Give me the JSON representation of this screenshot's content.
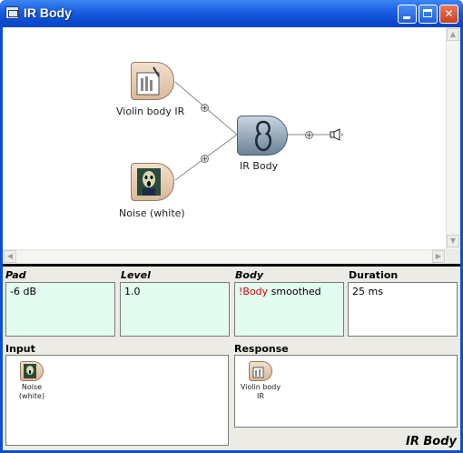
{
  "window": {
    "title": "IR Body"
  },
  "canvas": {
    "nodes": {
      "violin": {
        "label": "Violin body IR"
      },
      "noise": {
        "label": "Noise (white)"
      },
      "irbody": {
        "label": "IR Body"
      }
    }
  },
  "params": {
    "pad": {
      "label": "Pad",
      "value": "-6 dB"
    },
    "level": {
      "label": "Level",
      "value": "1.0"
    },
    "body": {
      "label": "Body",
      "prefix": "!Body",
      "value": " smoothed"
    },
    "duration": {
      "label": "Duration",
      "value": "25 ms"
    }
  },
  "input": {
    "label": "Input",
    "item_line1": "Noise",
    "item_line2": "(white)"
  },
  "response": {
    "label": "Response",
    "item_line1": "Violin body",
    "item_line2": "IR"
  },
  "footer": {
    "title": "IR Body"
  },
  "colors": {
    "titlebar": "#1c5fe0",
    "param_bg": "#e2fcf0",
    "accent_red": "#d40000"
  }
}
